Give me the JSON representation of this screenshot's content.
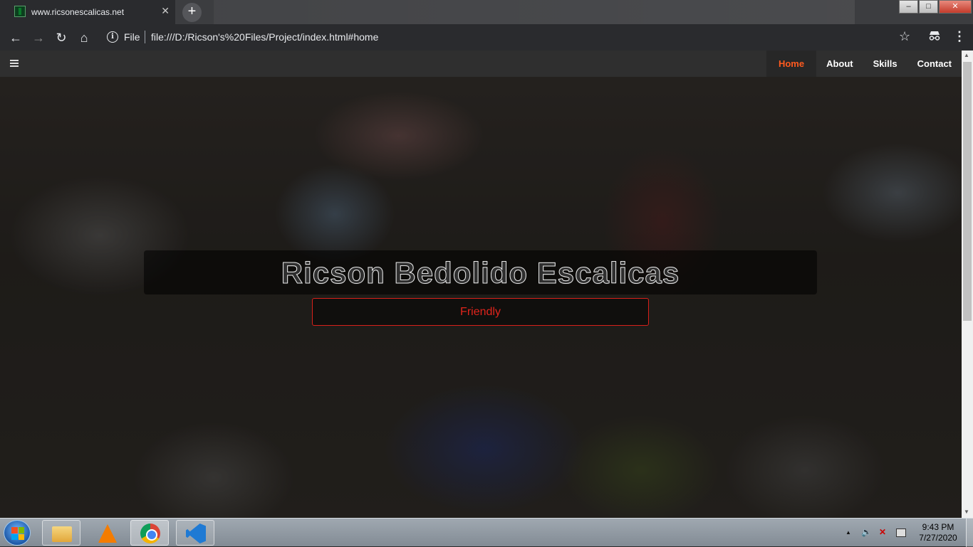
{
  "browser": {
    "tab": {
      "title": "www.ricsonescalicas.net",
      "close_glyph": "✕"
    },
    "new_tab_glyph": "+",
    "window_controls": {
      "minimize": "–",
      "maximize": "□",
      "close": "✕"
    },
    "toolbar": {
      "back_glyph": "←",
      "forward_glyph": "→",
      "reload_glyph": "↻",
      "home_glyph": "⌂"
    },
    "address": {
      "scheme_label": "File",
      "url": "file:///D:/Ricson's%20Files/Project/index.html#home",
      "info_glyph": "i"
    },
    "bookmark_glyph": "☆",
    "menu_glyph": "⋮"
  },
  "page": {
    "nav": {
      "items": [
        {
          "label": "Home",
          "active": true
        },
        {
          "label": "About",
          "active": false
        },
        {
          "label": "Skills",
          "active": false
        },
        {
          "label": "Contact",
          "active": false
        }
      ]
    },
    "hero": {
      "name": "Ricson Bedolido Escalicas",
      "trait": "Friendly"
    },
    "colors": {
      "accent": "#ff5a1f",
      "trait_border": "#d8201a",
      "trait_text": "#e0241c"
    }
  },
  "scrollbar": {
    "up_glyph": "▲",
    "down_glyph": "▼"
  },
  "taskbar": {
    "pinned": [
      "file-explorer-icon",
      "vlc-icon",
      "chrome-icon",
      "vscode-icon"
    ],
    "tray": {
      "expand_glyph": "▲",
      "volume_glyph": "🔈",
      "network_glyph": "✕"
    },
    "clock": {
      "time": "9:43 PM",
      "date": "7/27/2020"
    }
  }
}
